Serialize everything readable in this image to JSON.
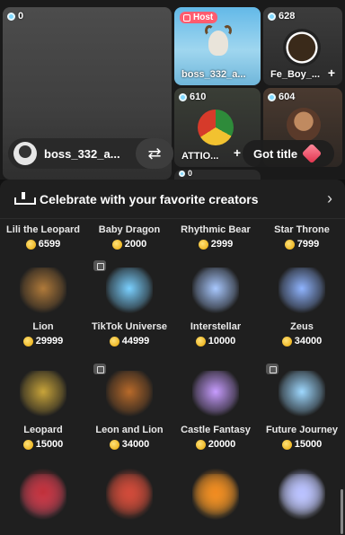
{
  "video_grid": {
    "main_tile": {
      "count": "0"
    },
    "host_tile": {
      "badge": "Host",
      "name": "boss_332_a..."
    },
    "tile_628": {
      "count": "628",
      "name": "Fe_Boy_..."
    },
    "tile_610": {
      "count": "610",
      "name": "ATTIO..."
    },
    "tile_604": {
      "count": "604"
    },
    "tile_bottom": {
      "count": "0"
    },
    "user_pill": {
      "name": "boss_332_a...",
      "swap_icon": "swap-arrows-icon"
    },
    "got_title": {
      "label": "Got title"
    },
    "plus_symbol": "+"
  },
  "panel": {
    "banner": {
      "text": "Celebrate with your favorite creators",
      "chevron": "›"
    },
    "gifts": [
      {
        "name": "Lili the Leopard",
        "price": "6599"
      },
      {
        "name": "Baby Dragon",
        "price": "2000"
      },
      {
        "name": "Rhythmic Bear",
        "price": "2999"
      },
      {
        "name": "Star Throne",
        "price": "7999"
      },
      {
        "name": "Lion",
        "price": "29999"
      },
      {
        "name": "TikTok Universe",
        "price": "44999"
      },
      {
        "name": "Interstellar",
        "price": "10000"
      },
      {
        "name": "Zeus",
        "price": "34000"
      },
      {
        "name": "Leopard",
        "price": "15000"
      },
      {
        "name": "Leon and Lion",
        "price": "34000"
      },
      {
        "name": "Castle Fantasy",
        "price": "20000"
      },
      {
        "name": "Future Journey",
        "price": "15000"
      },
      {
        "name": "",
        "price": ""
      },
      {
        "name": "",
        "price": ""
      },
      {
        "name": "",
        "price": ""
      },
      {
        "name": "",
        "price": ""
      }
    ],
    "art_colors": [
      "#b07a3a",
      "#7ad0ff",
      "#a8c8ff",
      "#8fb4ff",
      "#c8a43a",
      "#b86a2a",
      "#c79cff",
      "#9ed8ff",
      "#e05570",
      "#c9503a",
      "#f0a030",
      "#cfd6ff"
    ]
  }
}
